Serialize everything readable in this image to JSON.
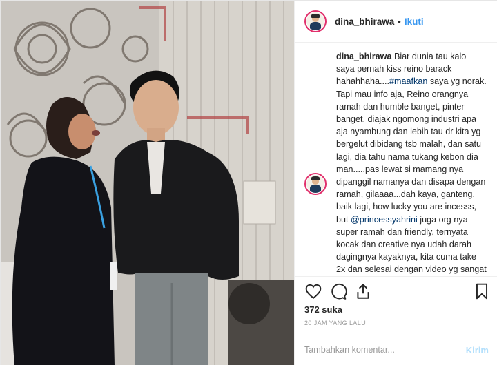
{
  "post": {
    "username": "dina_bhirawa",
    "separator": "•",
    "follow_label": "Ikuti",
    "caption": {
      "username": "dina_bhirawa",
      "text_before_hashtag": " Biar dunia tau kalo saya pernah kiss reino barack hahahhaha....",
      "hashtag": "#maafkan",
      "text_middle": " saya yg norak. Tapi mau info aja, Reino orangnya ramah dan humble banget, pinter banget, diajak ngomong industri apa aja nyambung dan lebih tau dr kita yg bergelut dibidang tsb malah, dan satu lagi, dia tahu nama tukang kebon dia man.....pas lewat si mamang nya dipanggil namanya dan disapa dengan ramah, gilaaaa...dah kaya, ganteng, baik lagi, how lucky you are incesss, but ",
      "mention": "@princessyahrini",
      "text_after_mention": " juga org nya super ramah dan friendly, ternyata kocak dan creative nya udah darah dagingnya kayaknya, kita cuma take 2x dan selesai dengan video yg sangat kocak. Wait ya guys....video nya di tiktok dan kalian harus ikut."
    },
    "likes": "372 suka",
    "timestamp": "20 JAM YANG LALU",
    "comment_placeholder": "Tambahkan komentar...",
    "send_label": "Kirim"
  },
  "icons": {
    "like": "heart-icon",
    "comment": "comment-icon",
    "share": "share-icon",
    "save": "bookmark-icon"
  },
  "colors": {
    "follow": "#3897f0",
    "hashtag": "#003569",
    "send_disabled": "#b2dffc",
    "avatar_ring": "#e1306c"
  }
}
